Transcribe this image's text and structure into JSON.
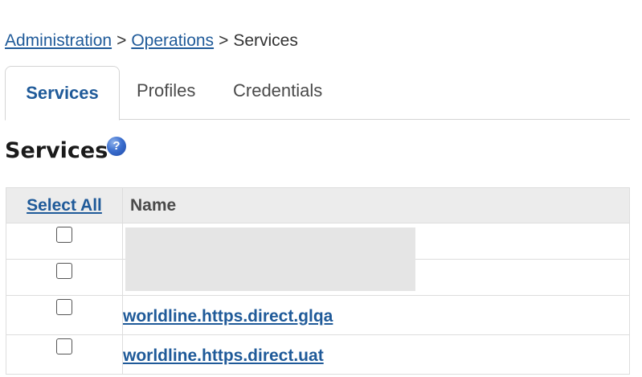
{
  "breadcrumb": {
    "items": [
      "Administration",
      "Operations"
    ],
    "separator": ">",
    "current": "Services"
  },
  "tabs": [
    {
      "label": "Services",
      "active": true
    },
    {
      "label": "Profiles",
      "active": false
    },
    {
      "label": "Credentials",
      "active": false
    }
  ],
  "page": {
    "title": "Services",
    "help_icon": "help-circle-icon",
    "help_glyph": "?"
  },
  "table": {
    "select_all_label": "Select All",
    "name_header": "Name",
    "rows": [
      {
        "name": "",
        "checked": false
      },
      {
        "name": "",
        "checked": false
      },
      {
        "name": "worldline.https.direct.glqa",
        "checked": false
      },
      {
        "name": "worldline.https.direct.uat",
        "checked": false
      }
    ]
  },
  "colors": {
    "link": "#1f5a99",
    "header_bg": "#ececec",
    "redaction": "#e5e5e5"
  }
}
